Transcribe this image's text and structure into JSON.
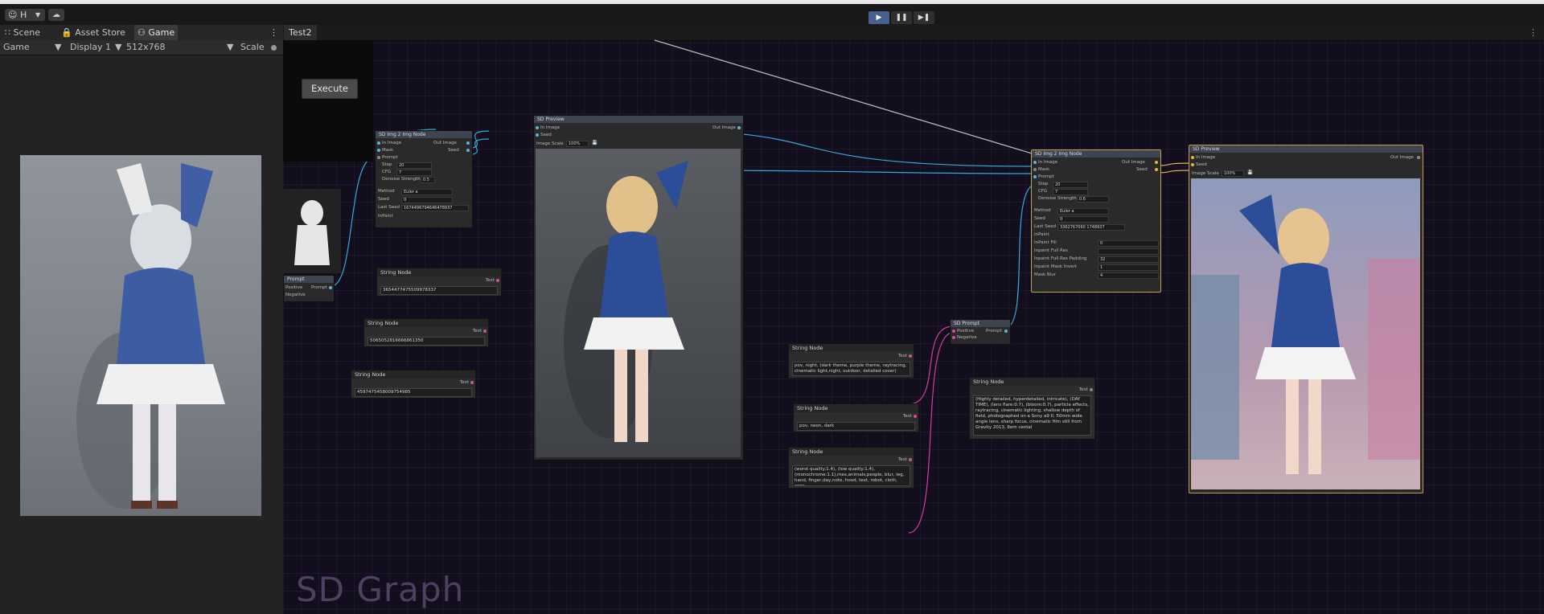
{
  "toolbar": {
    "account_label": "H",
    "account_icon": "account-icon",
    "cloud_icon": "cloud-icon",
    "play_icon": "play-icon",
    "pause_icon": "pause-icon",
    "step_icon": "step-icon"
  },
  "game_pane": {
    "tabs": [
      {
        "label": "Scene",
        "icon": "grid-icon"
      },
      {
        "label": "Asset Store",
        "icon": "lock-icon"
      },
      {
        "label": "Game",
        "icon": "gamepad-icon",
        "active": true
      }
    ],
    "game_dropdown": "Game",
    "display_dropdown": "Display 1",
    "resolution_dropdown": "512x768",
    "scale_label": "Scale"
  },
  "graph": {
    "tab_title": "Test2",
    "execute_label": "Execute",
    "graph_label": "SD Graph",
    "partial_prompt_node": {
      "title": "Prompt",
      "positive": "Positive",
      "negative": "Negative",
      "out": "Prompt"
    },
    "img2img_left": {
      "title": "SD Img 2 Img Node",
      "inputs": [
        "In Image",
        "Mask",
        "Prompt",
        "Step",
        "CFG",
        "Denoise Strength"
      ],
      "outputs": [
        "Out Image",
        "Seed"
      ],
      "step": "20",
      "cfg": "7",
      "denoise": "0.5",
      "method_label": "Method",
      "method_value": "Euler a",
      "seed_label": "Seed",
      "seed_value": "0",
      "last_seed_label": "Last Seed",
      "last_seed_value": "1674496794646478937",
      "inpaint_label": "InPaint"
    },
    "preview_center": {
      "title": "SD Preview",
      "inputs": [
        "In Image",
        "Seed"
      ],
      "output": "Out Image",
      "scale_label": "Image Scale",
      "scale_value": "100%"
    },
    "img2img_right": {
      "title": "SD Img 2 Img Node",
      "inputs": [
        "In Image",
        "Mask",
        "Prompt",
        "Step",
        "CFG",
        "Denoise Strength"
      ],
      "outputs": [
        "Out Image",
        "Seed"
      ],
      "step": "20",
      "cfg": "7",
      "denoise": "0.6",
      "method_label": "Method",
      "method_value": "Euler a",
      "seed_label": "Seed",
      "seed_value": "0",
      "last_seed_label": "Last Seed",
      "last_seed_value": "3362767060 1748937",
      "inpaint_label": "InPaint",
      "inpaint_rows": [
        {
          "label": "InPaint Fill",
          "value": "0"
        },
        {
          "label": "Inpaint Full Res",
          "value": ""
        },
        {
          "label": "Inpaint Full Res Padding",
          "value": "32"
        },
        {
          "label": "Inpaint Mask Invert",
          "value": "1"
        },
        {
          "label": "Mask Blur",
          "value": "4"
        }
      ]
    },
    "preview_right": {
      "title": "SD Preview",
      "inputs": [
        "In Image",
        "Seed"
      ],
      "output": "Out Image",
      "scale_label": "Image Scale",
      "scale_value": "100%"
    },
    "sd_prompt": {
      "title": "SD Prompt",
      "positive": "Positive",
      "negative": "Negative",
      "out": "Prompt"
    },
    "string_nodes": [
      {
        "title": "String Node",
        "text_label": "Text",
        "value": "3654477475509978337"
      },
      {
        "title": "String Node",
        "text_label": "Text",
        "value": "5065052816666861350"
      },
      {
        "title": "String Node",
        "text_label": "Text",
        "value": "4597475458009754985"
      },
      {
        "title": "String Node",
        "text_label": "Text",
        "value": "pov, night, (dark theme, purple theme, raytracing, cinematic light,night, outdoor, detailed cover)"
      },
      {
        "title": "String Node",
        "text_label": "Text",
        "value": "pov, neon, dark"
      },
      {
        "title": "String Node",
        "text_label": "Text",
        "value": "(worst quality:1.4), (low quality:1.4), (monochrome:1.1),mex,animals,people, blur, leg, hand, finger,day,note, hood, text, robot, cloth, cons"
      },
      {
        "title": "String Node",
        "text_label": "Text",
        "value": "(Highly detailed, hyperdetailed, intricate), (DAY TIME), (lens flare:0.7), (bloom:0.7), particle effects, raytracing, cinematic lighting, shallow depth of field, photographed on a Sony a9 II, 50mm wide angle lens, sharp focus, cinematic film still from Gravity 2013, 8em cental"
      }
    ]
  },
  "colors": {
    "wire_cyan": "#3aa8d8",
    "wire_pink": "#d63c9f",
    "wire_yellow": "#e0b44f",
    "graph_bg": "#120e1e"
  }
}
